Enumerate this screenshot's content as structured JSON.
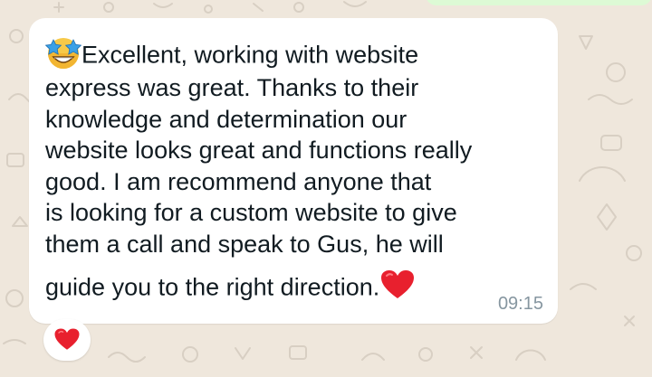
{
  "message": {
    "lines": [
      "Excellent, working with website",
      "express was great.  Thanks to their",
      "knowledge and determination our",
      "website looks great and functions really",
      "good.  I am recommend anyone that",
      "is looking for a custom website to give",
      "them a call and speak to Gus, he will",
      "guide you to the right direction."
    ],
    "leading_emoji": "star-struck-emoji",
    "trailing_emoji": "red-heart-emoji",
    "time": "09:15"
  },
  "reaction": {
    "emoji": "red-heart-emoji"
  },
  "colors": {
    "wallpaper": "#efe7dc",
    "bubble": "#ffffff",
    "text": "#111b21",
    "timestamp": "#8696a0",
    "heart": "#e8202e"
  }
}
